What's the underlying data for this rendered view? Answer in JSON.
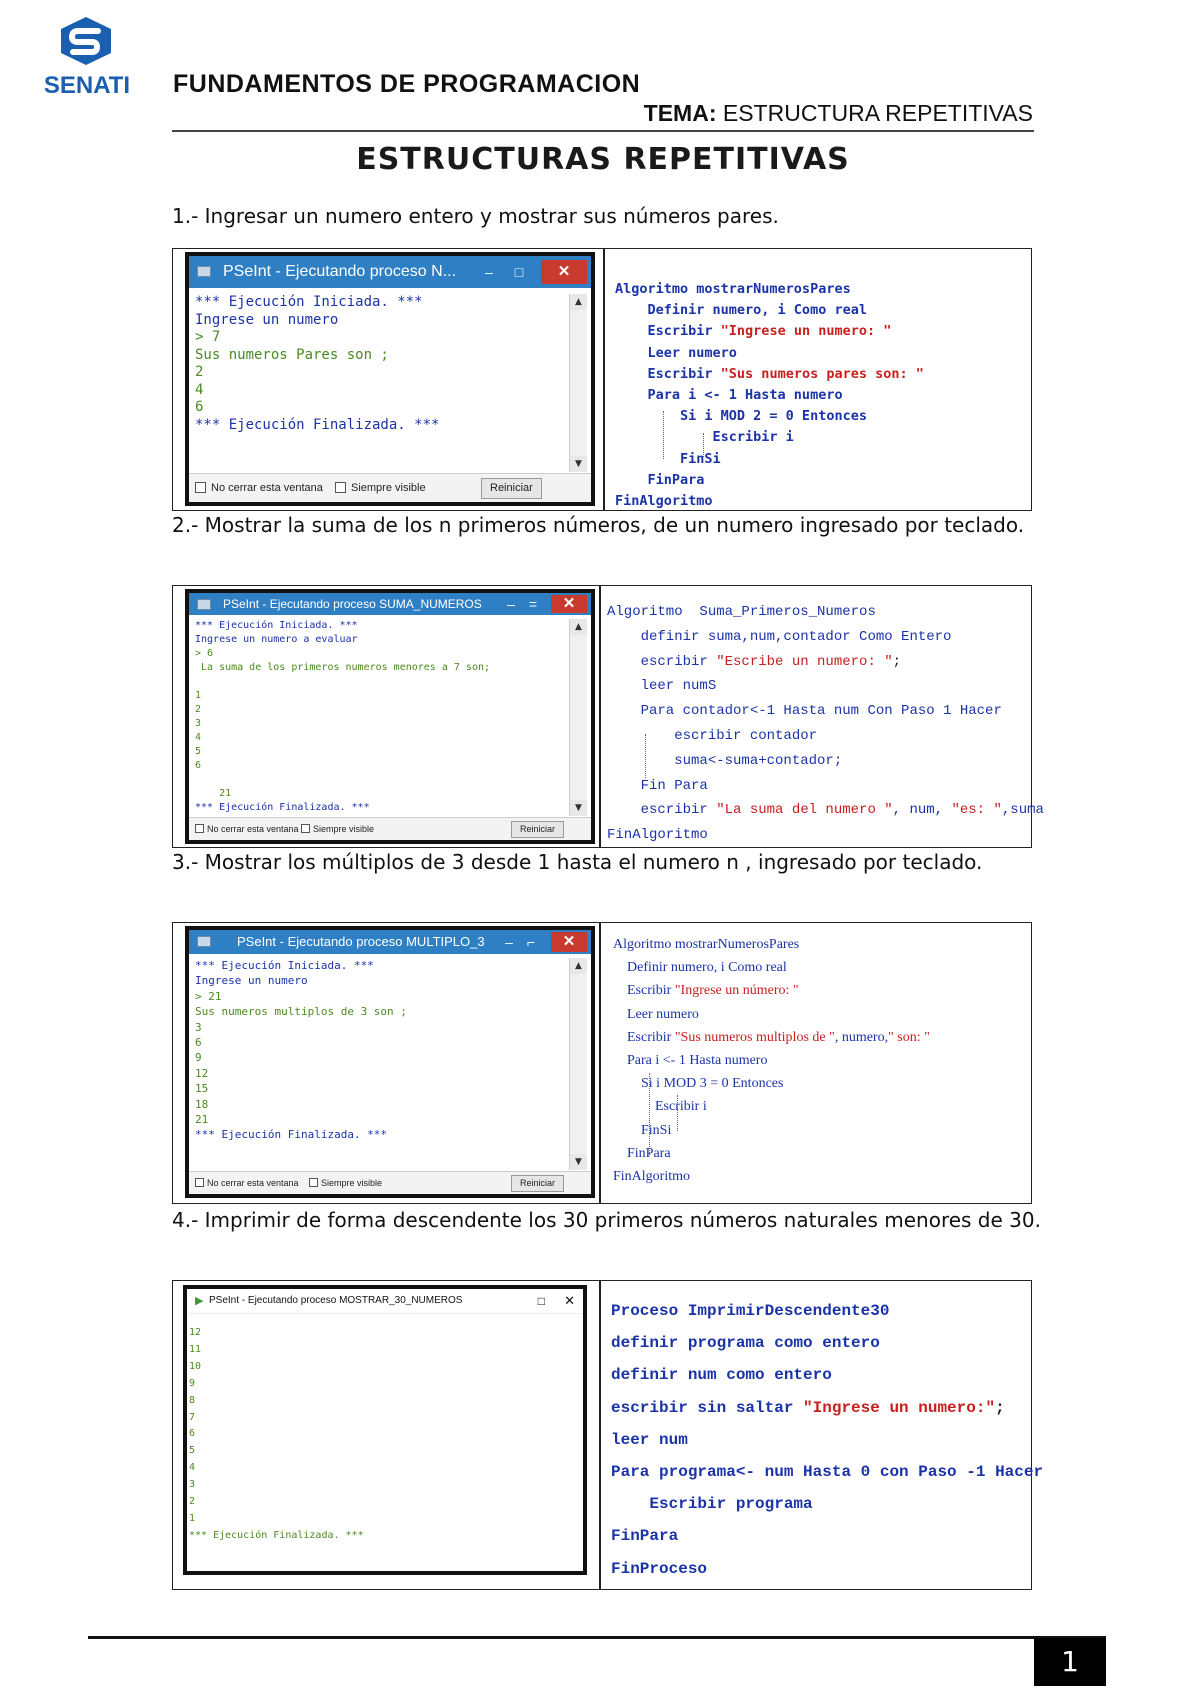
{
  "header": {
    "logo_text": "SENATI",
    "course": "FUNDAMENTOS DE PROGRAMACION",
    "tema_label": "TEMA:",
    "tema_value": "ESTRUCTURA REPETITIVAS"
  },
  "title": "ESTRUCTURAS REPETITIVAS",
  "exercises": [
    {
      "question": "1.- Ingresar un numero entero y mostrar sus números pares.",
      "window": {
        "title": "PSeInt - Ejecutando proceso N...",
        "console": [
          "*** Ejecución Iniciada. ***",
          "Ingrese un numero",
          "> 7",
          "Sus numeros Pares son ;",
          "2",
          "4",
          "6",
          "*** Ejecución Finalizada. ***"
        ],
        "checkbox1": "No cerrar esta ventana",
        "checkbox2": "Siempre visible",
        "button": "Reiniciar"
      },
      "code": [
        "Algoritmo mostrarNumerosPares",
        "    Definir numero, i Como real",
        "    Escribir \"Ingrese un numero: \"",
        "    Leer numero",
        "    Escribir \"Sus numeros pares son: \"",
        "    Para i <- 1 Hasta numero",
        "        Si i MOD 2 = 0 Entonces",
        "            Escribir i",
        "        FinSi",
        "    FinPara",
        "FinAlgoritmo"
      ]
    },
    {
      "question": "2.- Mostrar la suma de los n primeros números, de un numero ingresado por teclado.",
      "window": {
        "title": "PSeInt - Ejecutando proceso SUMA_NUMEROS",
        "console": [
          "*** Ejecución Iniciada. ***",
          "Ingrese un numero a evaluar",
          "> 6",
          " La suma de los primeros numeros menores a 7 son;",
          "",
          "1",
          "2",
          "3",
          "4",
          "5",
          "6",
          "",
          "    21",
          "*** Ejecución Finalizada. ***"
        ],
        "checkbox1": "No cerrar esta ventana",
        "checkbox2": "Siempre visible",
        "button": "Reiniciar"
      },
      "code": [
        "Algoritmo  Suma_Primeros_Numeros",
        "    definir suma,num,contador Como Entero",
        "    escribir \"Escribe un numero: \";",
        "    leer numS",
        "    Para contador<-1 Hasta num Con Paso 1 Hacer",
        "        escribir contador",
        "        suma<-suma+contador;",
        "    Fin Para",
        "    escribir \"La suma del numero \", num, \"es: \",suma",
        "FinAlgoritmo"
      ]
    },
    {
      "question": "3.- Mostrar los múltiplos de 3 desde 1 hasta el numero n , ingresado por teclado.",
      "window": {
        "title": "PSeInt - Ejecutando proceso MULTIPLO_3",
        "console": [
          "*** Ejecución Iniciada. ***",
          "Ingrese un numero",
          "> 21",
          "Sus numeros multiplos de 3 son ;",
          "3",
          "6",
          "9",
          "12",
          "15",
          "18",
          "21",
          "*** Ejecución Finalizada. ***"
        ],
        "checkbox1": "No cerrar esta ventana",
        "checkbox2": "Siempre visible",
        "button": "Reiniciar"
      },
      "code": [
        "Algoritmo mostrarNumerosPares",
        "    Definir numero, i Como real",
        "    Escribir \"Ingrese un número: \"",
        "    Leer numero",
        "    Escribir \"Sus numeros multiplos de \", numero,\" son: \"",
        "    Para i <- 1 Hasta numero",
        "        Si i MOD 3 = 0 Entonces",
        "            Escribir i",
        "        FinSi",
        "    FinPara",
        "FinAlgoritmo"
      ]
    },
    {
      "question": "4.- Imprimir de forma descendente los 30 primeros números naturales menores de 30.",
      "window": {
        "title": "PSeInt - Ejecutando proceso MOSTRAR_30_NUMEROS",
        "console": [
          "12",
          "11",
          "10",
          "9",
          "8",
          "7",
          "6",
          "5",
          "4",
          "3",
          "2",
          "1",
          "*** Ejecución Finalizada. ***"
        ]
      },
      "code": [
        "Proceso ImprimirDescendente30",
        "definir programa como entero",
        "definir num como entero",
        "escribir sin saltar \"Ingrese un numero:\";",
        "leer num",
        "Para programa<- num Hasta 0 con Paso -1 Hacer",
        "    Escribir programa",
        "FinPara",
        "FinProceso"
      ]
    }
  ],
  "page_number": "1"
}
